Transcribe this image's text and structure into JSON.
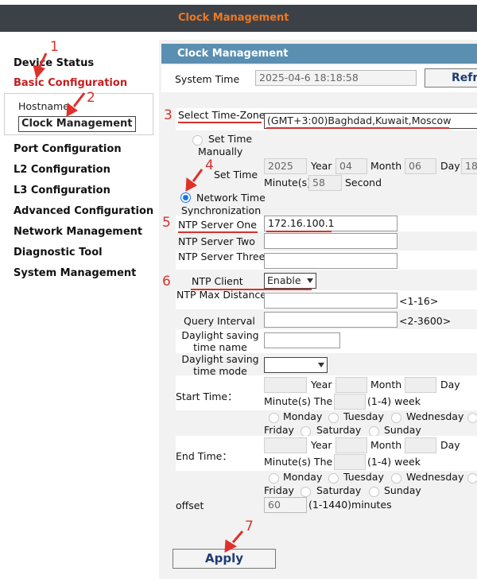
{
  "app_title": "Clock Management",
  "sidebar": {
    "items": [
      {
        "label": "Device Status"
      },
      {
        "label": "Basic Configuration",
        "active": true
      },
      {
        "label": "Port Configuration"
      },
      {
        "label": "L2 Configuration"
      },
      {
        "label": "L3 Configuration"
      },
      {
        "label": "Advanced Configuration"
      },
      {
        "label": "Network Management"
      },
      {
        "label": "Diagnostic Tool"
      },
      {
        "label": "System Management"
      }
    ],
    "subitems": [
      {
        "label": "Hostname"
      },
      {
        "label": "Clock Management",
        "selected": true
      }
    ]
  },
  "panel": {
    "title": "Clock Management",
    "system_time": {
      "label": "System Time",
      "value": "2025-04-6 18:18:58",
      "refresh_label": "Refr"
    },
    "timezone": {
      "label": "Select Time-Zone",
      "value": "(GMT+3:00)Baghdad,Kuwait,Moscow"
    },
    "manual": {
      "radio_label_1": "Set Time",
      "radio_label_2": "Manually",
      "set_time_label": "Set Time",
      "year": "2025",
      "year_label": "Year",
      "month": "04",
      "month_label": "Month",
      "day": "06",
      "day_label": "Day",
      "hour": "18",
      "minute_label": "Minute(s)",
      "minute": "58",
      "second_label": "Second"
    },
    "ntp": {
      "radio_label_1": "Network Time",
      "radio_label_2": "Synchronization",
      "server_one_label": "NTP Server One",
      "server_one": "172.16.100.1",
      "server_two_label": "NTP Server Two",
      "server_two": "",
      "server_three_label": "NTP Server Three",
      "server_three": "",
      "client_label": "NTP Client",
      "client_value": "Enable",
      "max_distance_label": "NTP Max Distance",
      "max_distance_hint": "<1-16>",
      "query_interval_label": "Query Interval",
      "query_interval_hint": "<2-3600>"
    },
    "dst": {
      "name_label_1": "Daylight saving",
      "name_label_2": "time name",
      "mode_label_1": "Daylight saving",
      "mode_label_2": "time mode",
      "start_label": "Start Time：",
      "end_label": "End Time：",
      "year_label": "Year",
      "month_label": "Month",
      "day_label": "Day",
      "minute_label": "Minute(s) The",
      "week_label": "(1-4) week",
      "days": {
        "monday": "Monday",
        "tuesday": "Tuesday",
        "wednesday": "Wednesday",
        "friday": "Friday",
        "saturday": "Saturday",
        "sunday": "Sunday"
      },
      "offset_label": "offset",
      "offset_value": "60",
      "offset_hint": "(1-1440)minutes"
    },
    "apply_label": "Apply"
  },
  "annotations": {
    "n1": "1",
    "n2": "2",
    "n3": "3",
    "n4": "4",
    "n5": "5",
    "n6": "6",
    "n7": "7"
  },
  "colors": {
    "header_bg": "#3c4148",
    "title_orange": "#f07820",
    "panel_header": "#5b8fb2",
    "active_red": "#c31f1f",
    "annotation_red": "#d6322c",
    "apply_text": "#1d3c77"
  }
}
